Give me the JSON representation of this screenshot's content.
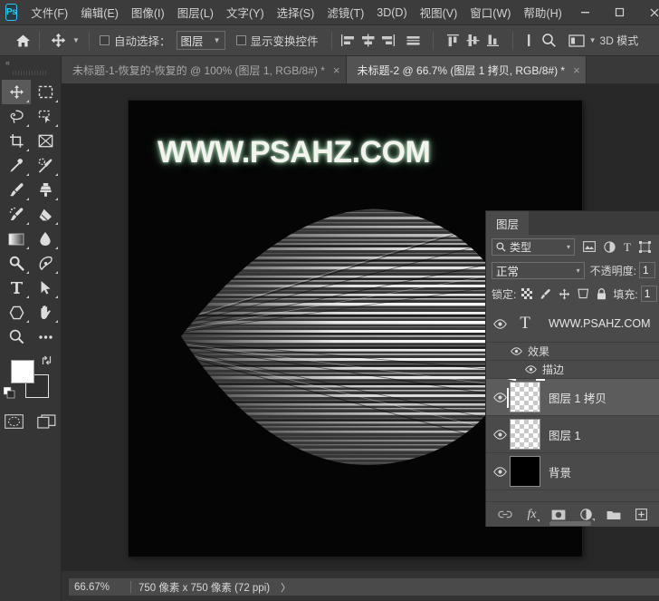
{
  "app": {
    "name": "Photoshop",
    "logo_text": "Ps"
  },
  "menubar": {
    "items": [
      {
        "label": "文件(F)",
        "name": "menu-file"
      },
      {
        "label": "编辑(E)",
        "name": "menu-edit"
      },
      {
        "label": "图像(I)",
        "name": "menu-image"
      },
      {
        "label": "图层(L)",
        "name": "menu-layer"
      },
      {
        "label": "文字(Y)",
        "name": "menu-type"
      },
      {
        "label": "选择(S)",
        "name": "menu-select"
      },
      {
        "label": "滤镜(T)",
        "name": "menu-filter"
      },
      {
        "label": "3D(D)",
        "name": "menu-3d"
      },
      {
        "label": "视图(V)",
        "name": "menu-view"
      },
      {
        "label": "窗口(W)",
        "name": "menu-window"
      },
      {
        "label": "帮助(H)",
        "name": "menu-help"
      }
    ],
    "window_controls": {
      "minimize": "—",
      "maximize": "▢",
      "close": "✕"
    }
  },
  "options_bar": {
    "home_icon": "home-icon",
    "tool_icon": "move-tool-icon",
    "auto_select_checked": false,
    "auto_select_label": "自动选择：",
    "auto_select_value": "图层",
    "show_transform_checked": false,
    "show_transform_label": "显示变换控件",
    "align_icons": [
      "align-left-icon",
      "align-center-h-icon",
      "align-right-icon",
      "distribute-h-icon"
    ],
    "align_icons2": [
      "align-top-icon",
      "align-middle-v-icon",
      "align-bottom-icon"
    ],
    "more_icon": "more-options-icon",
    "search_icon": "search-icon",
    "arrange_icon": "arrange-documents-icon",
    "mode_3d_label": "3D 模式"
  },
  "tabs": [
    {
      "title": "未标题-1-恢复的-恢复的 @ 100% (图层 1, RGB/8#) *",
      "active": false,
      "close": "×"
    },
    {
      "title": "未标题-2 @ 66.7% (图层 1 拷贝, RGB/8#) *",
      "active": true,
      "close": "×"
    }
  ],
  "toolbar": {
    "collapse_icon": "collapse-chevrons-icon",
    "tools": [
      {
        "name": "move-tool",
        "active": true,
        "has_flyout": true
      },
      {
        "name": "rectangular-marquee-tool",
        "active": false,
        "has_flyout": true
      },
      {
        "name": "lasso-tool",
        "active": false,
        "has_flyout": true
      },
      {
        "name": "quick-selection-tool",
        "active": false,
        "has_flyout": true
      },
      {
        "name": "crop-tool",
        "active": false,
        "has_flyout": true
      },
      {
        "name": "frame-tool",
        "active": false,
        "has_flyout": false
      },
      {
        "name": "eyedropper-tool",
        "active": false,
        "has_flyout": true
      },
      {
        "name": "healing-brush-tool",
        "active": false,
        "has_flyout": true
      },
      {
        "name": "brush-tool",
        "active": false,
        "has_flyout": true
      },
      {
        "name": "clone-stamp-tool",
        "active": false,
        "has_flyout": true
      },
      {
        "name": "history-brush-tool",
        "active": false,
        "has_flyout": true
      },
      {
        "name": "eraser-tool",
        "active": false,
        "has_flyout": true
      },
      {
        "name": "gradient-tool",
        "active": false,
        "has_flyout": true
      },
      {
        "name": "blur-tool",
        "active": false,
        "has_flyout": true
      },
      {
        "name": "dodge-tool",
        "active": false,
        "has_flyout": true
      },
      {
        "name": "pen-tool",
        "active": false,
        "has_flyout": true
      },
      {
        "name": "horizontal-type-tool",
        "active": false,
        "has_flyout": true
      },
      {
        "name": "path-selection-tool",
        "active": false,
        "has_flyout": true
      },
      {
        "name": "shape-tool",
        "active": false,
        "has_flyout": true
      },
      {
        "name": "hand-tool",
        "active": false,
        "has_flyout": true
      },
      {
        "name": "zoom-tool",
        "active": false,
        "has_flyout": false
      },
      {
        "name": "edit-toolbar-tool",
        "active": false,
        "has_flyout": false
      }
    ],
    "foreground_color": "#ffffff",
    "background_color": "#2f2f2f",
    "swap_icon": "swap-colors-icon",
    "default_icon": "default-colors-icon",
    "quick_mask_icon": "quick-mask-icon",
    "screen_mode_icon": "screen-mode-icon"
  },
  "canvas": {
    "text_layer_content": "WWW.PSAHZ.COM",
    "background_color": "#050505",
    "workspace_color": "#282828"
  },
  "statusbar": {
    "zoom": "66.67%",
    "doc_size": "750 像素 x 750 像素 (72 ppi)",
    "expand_arrow": "〉"
  },
  "layers_panel": {
    "tab_label": "图层",
    "filter": {
      "icon": "search-icon",
      "value": "类型",
      "caret": "▾",
      "type_icons": [
        "pixel-filter-icon",
        "adjustment-filter-icon",
        "type-filter-icon",
        "shape-filter-icon"
      ]
    },
    "blend_mode": "正常",
    "blend_caret": "▾",
    "opacity_label": "不透明度:",
    "opacity_value": "1",
    "lock_label": "锁定:",
    "lock_icons": [
      "lock-transparent-pixels-icon",
      "lock-image-pixels-icon",
      "lock-position-icon",
      "lock-artboard-icon",
      "lock-all-icon"
    ],
    "fill_label": "填充:",
    "fill_value": "1",
    "layers": [
      {
        "name": "WWW.PSAHZ.COM",
        "kind": "text",
        "visible": true,
        "selected": false,
        "effects": [
          {
            "name": "效果",
            "visible": true
          },
          {
            "name": "描边",
            "visible": true
          }
        ]
      },
      {
        "name": "图层 1 拷贝",
        "kind": "pixel",
        "visible": true,
        "selected": true,
        "effects": []
      },
      {
        "name": "图层 1",
        "kind": "pixel",
        "visible": true,
        "selected": false,
        "effects": []
      },
      {
        "name": "背景",
        "kind": "background",
        "visible": true,
        "selected": false,
        "effects": []
      }
    ],
    "footer_icons": [
      "link-layers-icon",
      "add-layer-style-icon",
      "add-layer-mask-icon",
      "new-adjustment-layer-icon",
      "new-group-icon",
      "new-layer-icon"
    ]
  }
}
